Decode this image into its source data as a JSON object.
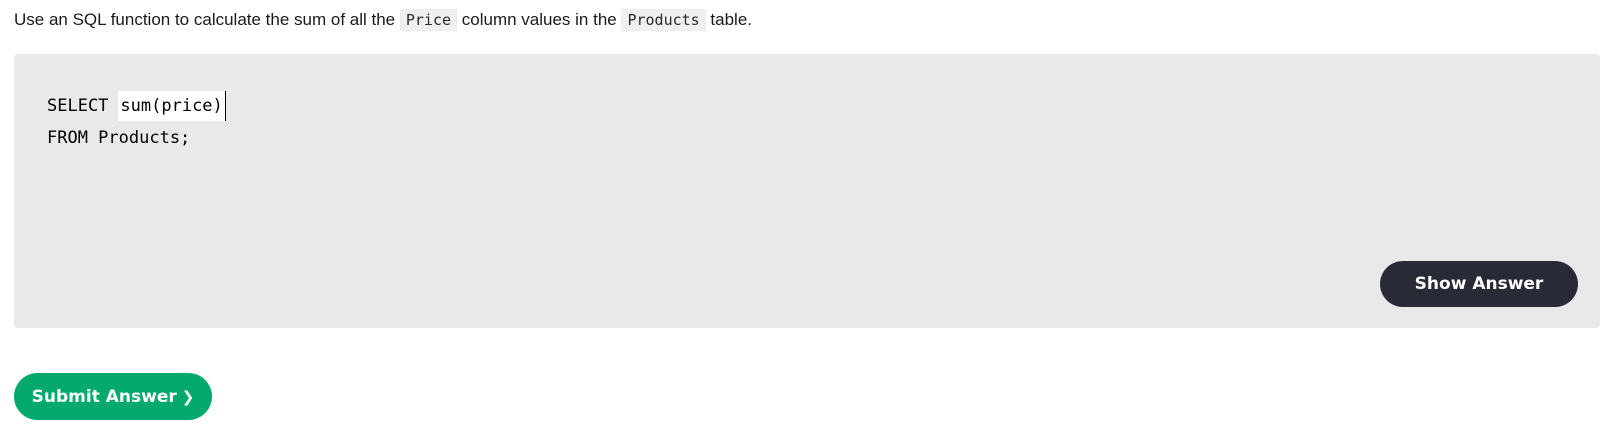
{
  "instructions": {
    "part1": "Use an SQL function to calculate the sum of all the ",
    "code1": "Price",
    "part2": " column values in the ",
    "code2": "Products",
    "part3": " table."
  },
  "code": {
    "line1_keyword": "SELECT",
    "line1_input_value": "sum(price)",
    "line2": "FROM Products;"
  },
  "buttons": {
    "show_answer": "Show Answer",
    "submit": "Submit Answer",
    "submit_icon": "chevron-right-icon"
  },
  "colors": {
    "exercise_bg": "#e7e9eb",
    "show_answer_bg": "#282a35",
    "submit_bg": "#04aa6d"
  }
}
